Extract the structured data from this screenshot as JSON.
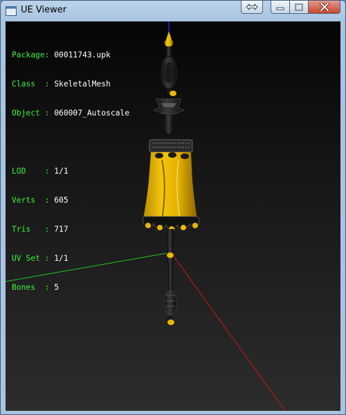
{
  "window": {
    "title": "UE Viewer",
    "controls": {
      "restore_full": "restore-fullscreen-icon",
      "minimize": "minimize-icon",
      "maximize": "maximize-icon",
      "close": "close-icon"
    }
  },
  "info": {
    "package": {
      "label": "Package",
      "sep": ": ",
      "value": "00011743.upk"
    },
    "class": {
      "label": "Class  ",
      "sep": ": ",
      "value": "SkeletalMesh"
    },
    "object": {
      "label": "Object ",
      "sep": ": ",
      "value": "060007_Autoscale"
    },
    "lod": {
      "label": "LOD    ",
      "sep": ": ",
      "value": "1/1"
    },
    "verts": {
      "label": "Verts  ",
      "sep": ": ",
      "value": "605"
    },
    "tris": {
      "label": "Tris   ",
      "sep": ": ",
      "value": "717"
    },
    "uvset": {
      "label": "UV Set ",
      "sep": ": ",
      "value": "1/1"
    },
    "bones": {
      "label": "Bones  ",
      "sep": ": ",
      "value": "5"
    }
  },
  "colors": {
    "label_green": "#3cf23c",
    "value_white": "#ffffff",
    "axis_x": "#d01818",
    "axis_y": "#1ec81e",
    "axis_z": "#2030ff",
    "mesh_gold": "#e6b60a",
    "mesh_dark": "#141414"
  }
}
